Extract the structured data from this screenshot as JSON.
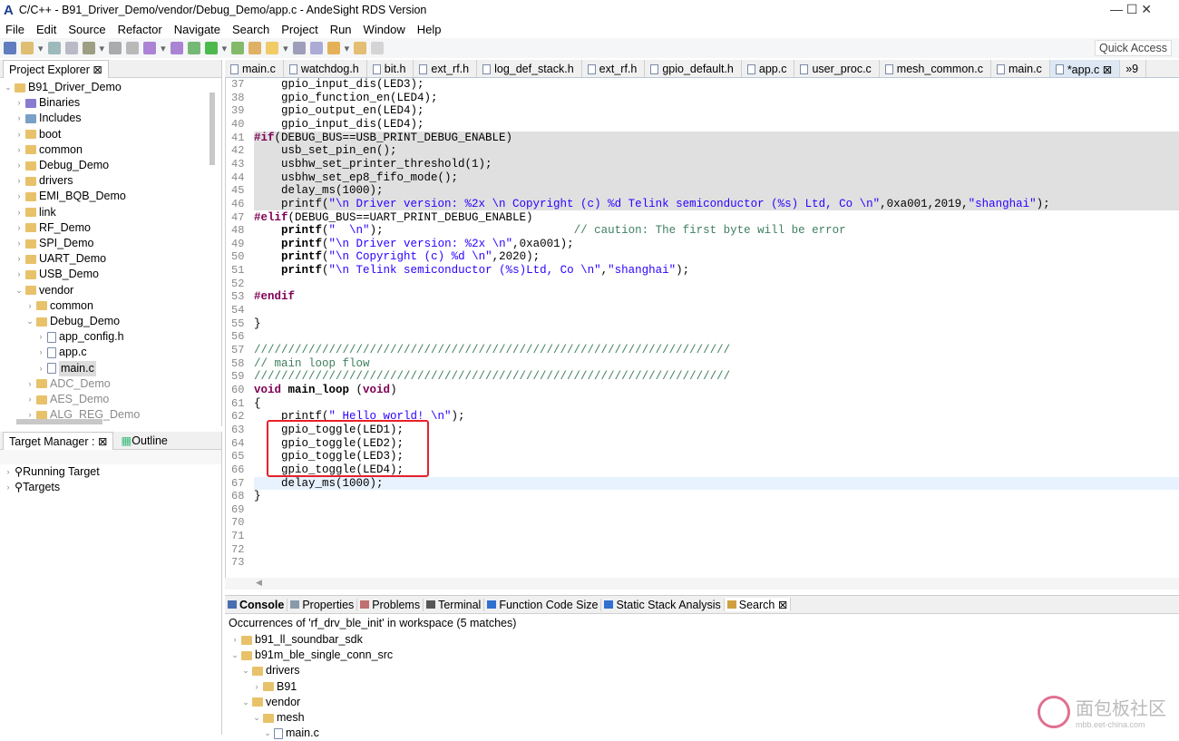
{
  "window": {
    "title": "C/C++ - B91_Driver_Demo/vendor/Debug_Demo/app.c - AndeSight RDS Version",
    "controls": "—   ☐   ✕"
  },
  "menu": [
    "File",
    "Edit",
    "Source",
    "Refactor",
    "Navigate",
    "Search",
    "Project",
    "Run",
    "Window",
    "Help"
  ],
  "quick_access": "Quick Access",
  "project_explorer": {
    "title": "Project Explorer ⊠",
    "items": [
      {
        "d": 0,
        "tw": "⌄",
        "ic": "fold",
        "label": "B91_Driver_Demo"
      },
      {
        "d": 1,
        "tw": "›",
        "ic": "bin",
        "label": "Binaries"
      },
      {
        "d": 1,
        "tw": "›",
        "ic": "inc",
        "label": "Includes"
      },
      {
        "d": 1,
        "tw": "›",
        "ic": "fold",
        "label": "boot"
      },
      {
        "d": 1,
        "tw": "›",
        "ic": "fold",
        "label": "common"
      },
      {
        "d": 1,
        "tw": "›",
        "ic": "fold",
        "label": "Debug_Demo"
      },
      {
        "d": 1,
        "tw": "›",
        "ic": "fold",
        "label": "drivers"
      },
      {
        "d": 1,
        "tw": "›",
        "ic": "fold",
        "label": "EMI_BQB_Demo"
      },
      {
        "d": 1,
        "tw": "›",
        "ic": "fold",
        "label": "link"
      },
      {
        "d": 1,
        "tw": "›",
        "ic": "fold",
        "label": "RF_Demo"
      },
      {
        "d": 1,
        "tw": "›",
        "ic": "fold",
        "label": "SPI_Demo"
      },
      {
        "d": 1,
        "tw": "›",
        "ic": "fold",
        "label": "UART_Demo"
      },
      {
        "d": 1,
        "tw": "›",
        "ic": "fold",
        "label": "USB_Demo"
      },
      {
        "d": 1,
        "tw": "⌄",
        "ic": "fold",
        "label": "vendor"
      },
      {
        "d": 2,
        "tw": "›",
        "ic": "fold",
        "label": "common"
      },
      {
        "d": 2,
        "tw": "⌄",
        "ic": "fold",
        "label": "Debug_Demo"
      },
      {
        "d": 3,
        "tw": "›",
        "ic": "file",
        "label": "app_config.h"
      },
      {
        "d": 3,
        "tw": "›",
        "ic": "file",
        "label": "app.c"
      },
      {
        "d": 3,
        "tw": "›",
        "ic": "file",
        "label": "main.c",
        "sel": true
      },
      {
        "d": 2,
        "tw": "›",
        "ic": "fold",
        "label": "ADC_Demo",
        "dim": true
      },
      {
        "d": 2,
        "tw": "›",
        "ic": "fold",
        "label": "AES_Demo",
        "dim": true
      },
      {
        "d": 2,
        "tw": "›",
        "ic": "fold",
        "label": "ALG_REG_Demo",
        "dim": true
      }
    ]
  },
  "target_manager": {
    "title": "Target Manager : ⊠",
    "outline": "Outline",
    "items": [
      "Running Target",
      "Targets"
    ]
  },
  "editor_tabs": [
    {
      "label": "main.c"
    },
    {
      "label": "watchdog.h"
    },
    {
      "label": "bit.h"
    },
    {
      "label": "ext_rf.h"
    },
    {
      "label": "log_def_stack.h"
    },
    {
      "label": "ext_rf.h"
    },
    {
      "label": "gpio_default.h"
    },
    {
      "label": "app.c"
    },
    {
      "label": "user_proc.c"
    },
    {
      "label": "mesh_common.c"
    },
    {
      "label": "main.c"
    },
    {
      "label": "*app.c ⊠",
      "active": true
    },
    {
      "label": "»9"
    }
  ],
  "code": [
    {
      "n": "37",
      "s": [
        [
          "",
          "    gpio_input_dis(LED3);"
        ]
      ]
    },
    {
      "n": "38",
      "s": [
        [
          "",
          "    gpio_function_en(LED4);"
        ]
      ]
    },
    {
      "n": "39",
      "s": [
        [
          "",
          "    gpio_output_en(LED4);"
        ]
      ]
    },
    {
      "n": "40",
      "s": [
        [
          "",
          "    gpio_input_dis(LED4);"
        ]
      ]
    },
    {
      "n": "41",
      "shade": true,
      "s": [
        [
          "kw",
          "#if"
        ],
        [
          "",
          "(DEBUG_BUS==USB_PRINT_DEBUG_ENABLE)"
        ]
      ]
    },
    {
      "n": "42",
      "shade": true,
      "s": [
        [
          "",
          "    usb_set_pin_en();"
        ]
      ]
    },
    {
      "n": "43",
      "shade": true,
      "s": [
        [
          "",
          "    usbhw_set_printer_threshold(1);"
        ]
      ]
    },
    {
      "n": "44",
      "shade": true,
      "s": [
        [
          "",
          "    usbhw_set_ep8_fifo_mode();"
        ]
      ]
    },
    {
      "n": "45",
      "shade": true,
      "s": [
        [
          "",
          "    delay_ms(1000);"
        ]
      ]
    },
    {
      "n": "46",
      "shade": true,
      "s": [
        [
          "",
          "    printf("
        ],
        [
          "str",
          "\"\\n Driver version: %2x \\n Copyright (c) %d Telink semiconductor (%s) Ltd, Co \\n\""
        ],
        [
          "",
          ",0xa001,2019,"
        ],
        [
          "str",
          "\"shanghai\""
        ],
        [
          "",
          ");"
        ]
      ]
    },
    {
      "n": "47",
      "s": [
        [
          "kw",
          "#elif"
        ],
        [
          "",
          "(DEBUG_BUS==UART_PRINT_DEBUG_ENABLE)"
        ]
      ]
    },
    {
      "n": "48",
      "s": [
        [
          "",
          "    "
        ],
        [
          "b",
          "printf"
        ],
        [
          "",
          "("
        ],
        [
          "str",
          "\"  \\n\""
        ],
        [
          "",
          ");                            "
        ],
        [
          "cm",
          "// caution: The first byte will be error"
        ]
      ]
    },
    {
      "n": "49",
      "s": [
        [
          "",
          "    "
        ],
        [
          "b",
          "printf"
        ],
        [
          "",
          "("
        ],
        [
          "str",
          "\"\\n Driver version: %2x \\n\""
        ],
        [
          "",
          ",0xa001);"
        ]
      ]
    },
    {
      "n": "50",
      "s": [
        [
          "",
          "    "
        ],
        [
          "b",
          "printf"
        ],
        [
          "",
          "("
        ],
        [
          "str",
          "\"\\n Copyright (c) %d \\n\""
        ],
        [
          "",
          ",2020);"
        ]
      ]
    },
    {
      "n": "51",
      "s": [
        [
          "",
          "    "
        ],
        [
          "b",
          "printf"
        ],
        [
          "",
          "("
        ],
        [
          "str",
          "\"\\n Telink semiconductor (%s)Ltd, Co \\n\""
        ],
        [
          "",
          ","
        ],
        [
          "str",
          "\"shanghai\""
        ],
        [
          "",
          ");"
        ]
      ]
    },
    {
      "n": "52",
      "s": []
    },
    {
      "n": "53",
      "s": [
        [
          "kw",
          "#endif"
        ]
      ]
    },
    {
      "n": "54",
      "s": []
    },
    {
      "n": "55",
      "s": [
        [
          "",
          "}"
        ]
      ]
    },
    {
      "n": "56",
      "s": []
    },
    {
      "n": "57",
      "s": [
        [
          "cm",
          "//////////////////////////////////////////////////////////////////////"
        ]
      ]
    },
    {
      "n": "58",
      "s": [
        [
          "cm",
          "// main loop flow"
        ]
      ]
    },
    {
      "n": "59",
      "s": [
        [
          "cm",
          "//////////////////////////////////////////////////////////////////////"
        ]
      ]
    },
    {
      "n": "60",
      "s": [
        [
          "kw",
          "void"
        ],
        [
          "",
          ""
        ],
        [
          "b",
          " main_loop"
        ],
        [
          "",
          " ("
        ],
        [
          "kw",
          "void"
        ],
        [
          "",
          ")"
        ]
      ]
    },
    {
      "n": "61",
      "s": [
        [
          "",
          "{"
        ]
      ]
    },
    {
      "n": "62",
      "s": [
        [
          "",
          "    printf("
        ],
        [
          "str",
          "\" Hello world! \\n\""
        ],
        [
          "",
          ");"
        ]
      ]
    },
    {
      "n": "63",
      "s": [
        [
          "",
          "    gpio_toggle(LED1);"
        ]
      ]
    },
    {
      "n": "64",
      "s": [
        [
          "",
          "    gpio_toggle(LED2);"
        ]
      ]
    },
    {
      "n": "65",
      "s": [
        [
          "",
          "    gpio_toggle(LED3);"
        ]
      ]
    },
    {
      "n": "66",
      "s": [
        [
          "",
          "    gpio_toggle(LED4);"
        ]
      ]
    },
    {
      "n": "67",
      "cur": true,
      "s": [
        [
          "",
          "    delay_ms(1000);"
        ]
      ]
    },
    {
      "n": "68",
      "s": [
        [
          "",
          "}"
        ]
      ]
    },
    {
      "n": "69",
      "s": []
    },
    {
      "n": "70",
      "s": []
    },
    {
      "n": "71",
      "s": []
    },
    {
      "n": "72",
      "s": []
    },
    {
      "n": "73",
      "s": []
    }
  ],
  "bottom": {
    "tabs": [
      {
        "label": "Console",
        "bold": true,
        "color": "#4a6fb0"
      },
      {
        "label": "Properties",
        "color": "#8899aa"
      },
      {
        "label": "Problems",
        "color": "#c07070"
      },
      {
        "label": "Terminal",
        "color": "#555"
      },
      {
        "label": "Function Code Size",
        "color": "#3070d0"
      },
      {
        "label": "Static Stack Analysis",
        "color": "#3070d0"
      },
      {
        "label": "Search ⊠",
        "color": "#d0a040",
        "active": true
      }
    ],
    "summary": "Occurrences of 'rf_drv_ble_init' in workspace (5 matches)",
    "results": [
      {
        "d": 0,
        "tw": "›",
        "ic": "fold",
        "label": "b91_ll_soundbar_sdk"
      },
      {
        "d": 0,
        "tw": "⌄",
        "ic": "fold",
        "label": "b91m_ble_single_conn_src"
      },
      {
        "d": 1,
        "tw": "⌄",
        "ic": "fold",
        "label": "drivers"
      },
      {
        "d": 2,
        "tw": "›",
        "ic": "fold",
        "label": "B91"
      },
      {
        "d": 1,
        "tw": "⌄",
        "ic": "fold",
        "label": "vendor"
      },
      {
        "d": 2,
        "tw": "⌄",
        "ic": "fold",
        "label": "mesh"
      },
      {
        "d": 3,
        "tw": "⌄",
        "ic": "file",
        "label": "main.c"
      }
    ]
  },
  "watermark": {
    "text": "面包板社区",
    "sub": "mbb.eet-china.com"
  }
}
